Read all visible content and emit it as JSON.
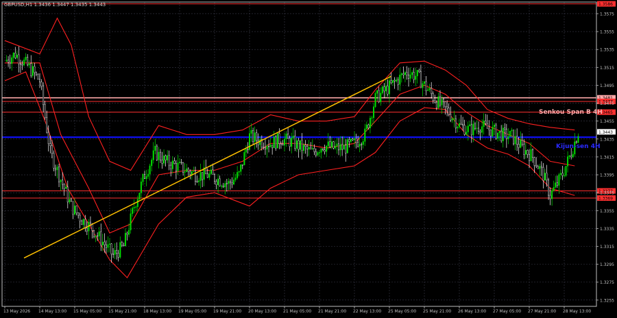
{
  "header": {
    "symbol_text": "GBPUSD,H1  1.3436 1.3447 1.3435 1.3443"
  },
  "labels": {
    "senkou": "Senkou Span B 4H",
    "kijun": "Kijun-sen 4H"
  },
  "colors": {
    "background": "#000000",
    "grid": "#3a3a4a",
    "axis": "#c0c0c0",
    "bull": "#00e000",
    "bear": "#ffffff",
    "envelope": "#ff2020",
    "trendline": "#ffc000",
    "senkou_line": "#ffaaaa",
    "kijun_line": "#1010ff",
    "level_red": "#ff3030",
    "price_box": "#ffffff"
  },
  "chart_data": {
    "type": "candlestick",
    "title": "GBPUSD,H1  1.3436 1.3447 1.3435 1.3443",
    "ylim": [
      1.3248,
      1.3588
    ],
    "y_ticks": [
      "1.3575",
      "1.3555",
      "1.3535",
      "1.3515",
      "1.3495",
      "1.3475",
      "1.3455",
      "1.3435",
      "1.3415",
      "1.3395",
      "1.3375",
      "1.3355",
      "1.3335",
      "1.3315",
      "1.3295",
      "1.3275",
      "1.3255"
    ],
    "x_ticks": [
      "13 May 2026",
      "14 May 13:00",
      "15 May 05:00",
      "15 May 21:00",
      "18 May 13:00",
      "19 May 05:00",
      "19 May 21:00",
      "20 May 13:00",
      "21 May 05:00",
      "21 May 21:00",
      "22 May 13:00",
      "25 May 05:00",
      "25 May 21:00",
      "26 May 13:00",
      "27 May 05:00",
      "27 May 21:00",
      "28 May 13:00"
    ],
    "grid": true,
    "horizontal_levels": [
      {
        "name": "top-level",
        "value": 1.3586,
        "label": "1.3586",
        "color": "#ff3030",
        "style": "solid"
      },
      {
        "name": "senkou-span-b-4h",
        "value": 1.3481,
        "label": "1.3481",
        "color": "#ffaaaa",
        "style": "solid"
      },
      {
        "name": "level-1.3477",
        "value": 1.3477,
        "label": "1.3477",
        "color": "#ff3030",
        "style": "solid"
      },
      {
        "name": "level-1.3465",
        "value": 1.3465,
        "label": "1.3465",
        "color": "#ff3030",
        "style": "solid"
      },
      {
        "name": "kijun-sen-4h",
        "value": 1.3437,
        "label": "",
        "color": "#1010ff",
        "style": "solid"
      },
      {
        "name": "level-1.3377",
        "value": 1.3377,
        "label": "1.3377",
        "color": "#ff3030",
        "style": "solid"
      },
      {
        "name": "level-1.3369",
        "value": 1.3369,
        "label": "1.3369",
        "color": "#ff3030",
        "style": "solid"
      }
    ],
    "current_price": {
      "value": 1.3443,
      "label": "1.3443"
    },
    "trendline": {
      "from": {
        "x_index": 0.55,
        "y": 1.3302
      },
      "to": {
        "x_index": 11.05,
        "y": 1.3505
      }
    },
    "price_path": [
      [
        0.0,
        1.3522
      ],
      [
        0.3,
        1.353
      ],
      [
        0.7,
        1.3515
      ],
      [
        1.0,
        1.35
      ],
      [
        1.3,
        1.342
      ],
      [
        1.6,
        1.339
      ],
      [
        1.9,
        1.336
      ],
      [
        2.2,
        1.3345
      ],
      [
        2.5,
        1.3335
      ],
      [
        2.8,
        1.332
      ],
      [
        3.1,
        1.3305
      ],
      [
        3.4,
        1.3315
      ],
      [
        3.7,
        1.336
      ],
      [
        4.0,
        1.3395
      ],
      [
        4.3,
        1.342
      ],
      [
        4.6,
        1.341
      ],
      [
        4.9,
        1.3405
      ],
      [
        5.2,
        1.34
      ],
      [
        5.5,
        1.3395
      ],
      [
        5.8,
        1.3395
      ],
      [
        6.1,
        1.339
      ],
      [
        6.4,
        1.3385
      ],
      [
        6.7,
        1.3395
      ],
      [
        7.0,
        1.3438
      ],
      [
        7.3,
        1.3433
      ],
      [
        7.6,
        1.343
      ],
      [
        7.9,
        1.3435
      ],
      [
        8.2,
        1.3432
      ],
      [
        8.5,
        1.3425
      ],
      [
        8.8,
        1.342
      ],
      [
        9.1,
        1.3428
      ],
      [
        9.4,
        1.3425
      ],
      [
        9.7,
        1.3425
      ],
      [
        10.0,
        1.343
      ],
      [
        10.3,
        1.344
      ],
      [
        10.6,
        1.348
      ],
      [
        10.9,
        1.349
      ],
      [
        11.2,
        1.35
      ],
      [
        11.5,
        1.351
      ],
      [
        11.8,
        1.3505
      ],
      [
        12.1,
        1.349
      ],
      [
        12.4,
        1.3475
      ],
      [
        12.7,
        1.3465
      ],
      [
        13.0,
        1.345
      ],
      [
        13.3,
        1.3445
      ],
      [
        13.6,
        1.345
      ],
      [
        13.9,
        1.3445
      ],
      [
        14.2,
        1.344
      ],
      [
        14.5,
        1.3438
      ],
      [
        14.8,
        1.3425
      ],
      [
        15.1,
        1.3415
      ],
      [
        15.4,
        1.3395
      ],
      [
        15.6,
        1.3372
      ],
      [
        15.8,
        1.3385
      ],
      [
        16.0,
        1.34
      ],
      [
        16.2,
        1.342
      ],
      [
        16.4,
        1.3443
      ]
    ],
    "envelope_upper": [
      [
        0.0,
        1.3545
      ],
      [
        1.0,
        1.353
      ],
      [
        1.5,
        1.357
      ],
      [
        1.9,
        1.354
      ],
      [
        2.4,
        1.346
      ],
      [
        3.0,
        1.341
      ],
      [
        3.6,
        1.34
      ],
      [
        4.4,
        1.345
      ],
      [
        5.2,
        1.344
      ],
      [
        6.0,
        1.344
      ],
      [
        6.8,
        1.3445
      ],
      [
        7.6,
        1.3462
      ],
      [
        8.4,
        1.3455
      ],
      [
        9.2,
        1.3455
      ],
      [
        10.0,
        1.346
      ],
      [
        10.6,
        1.349
      ],
      [
        11.3,
        1.352
      ],
      [
        12.0,
        1.3522
      ],
      [
        12.6,
        1.3512
      ],
      [
        13.2,
        1.3495
      ],
      [
        13.8,
        1.3468
      ],
      [
        14.4,
        1.3458
      ],
      [
        15.0,
        1.3452
      ],
      [
        15.6,
        1.3448
      ],
      [
        16.3,
        1.3445
      ]
    ],
    "envelope_lower": [
      [
        0.0,
        1.35
      ],
      [
        0.6,
        1.351
      ],
      [
        1.2,
        1.345
      ],
      [
        1.8,
        1.338
      ],
      [
        2.4,
        1.334
      ],
      [
        3.0,
        1.33
      ],
      [
        3.5,
        1.328
      ],
      [
        3.8,
        1.33
      ],
      [
        4.4,
        1.334
      ],
      [
        5.2,
        1.337
      ],
      [
        6.0,
        1.3375
      ],
      [
        7.0,
        1.336
      ],
      [
        7.6,
        1.338
      ],
      [
        8.4,
        1.3395
      ],
      [
        9.2,
        1.34
      ],
      [
        10.0,
        1.3405
      ],
      [
        10.6,
        1.342
      ],
      [
        11.3,
        1.3455
      ],
      [
        12.0,
        1.347
      ],
      [
        12.6,
        1.3468
      ],
      [
        13.2,
        1.344
      ],
      [
        13.8,
        1.3425
      ],
      [
        14.4,
        1.3418
      ],
      [
        15.0,
        1.3405
      ],
      [
        15.6,
        1.338
      ],
      [
        16.3,
        1.3372
      ]
    ],
    "envelope_mid": [
      [
        0.0,
        1.352
      ],
      [
        1.0,
        1.352
      ],
      [
        1.6,
        1.344
      ],
      [
        2.4,
        1.338
      ],
      [
        3.0,
        1.333
      ],
      [
        3.6,
        1.334
      ],
      [
        4.4,
        1.3395
      ],
      [
        5.2,
        1.34
      ],
      [
        6.0,
        1.34
      ],
      [
        6.8,
        1.341
      ],
      [
        7.6,
        1.343
      ],
      [
        8.4,
        1.343
      ],
      [
        9.2,
        1.3425
      ],
      [
        10.0,
        1.343
      ],
      [
        10.6,
        1.3455
      ],
      [
        11.3,
        1.3485
      ],
      [
        12.0,
        1.3495
      ],
      [
        12.6,
        1.3485
      ],
      [
        13.2,
        1.3465
      ],
      [
        13.8,
        1.345
      ],
      [
        14.4,
        1.344
      ],
      [
        15.0,
        1.343
      ],
      [
        15.6,
        1.341
      ],
      [
        16.3,
        1.3405
      ]
    ]
  }
}
